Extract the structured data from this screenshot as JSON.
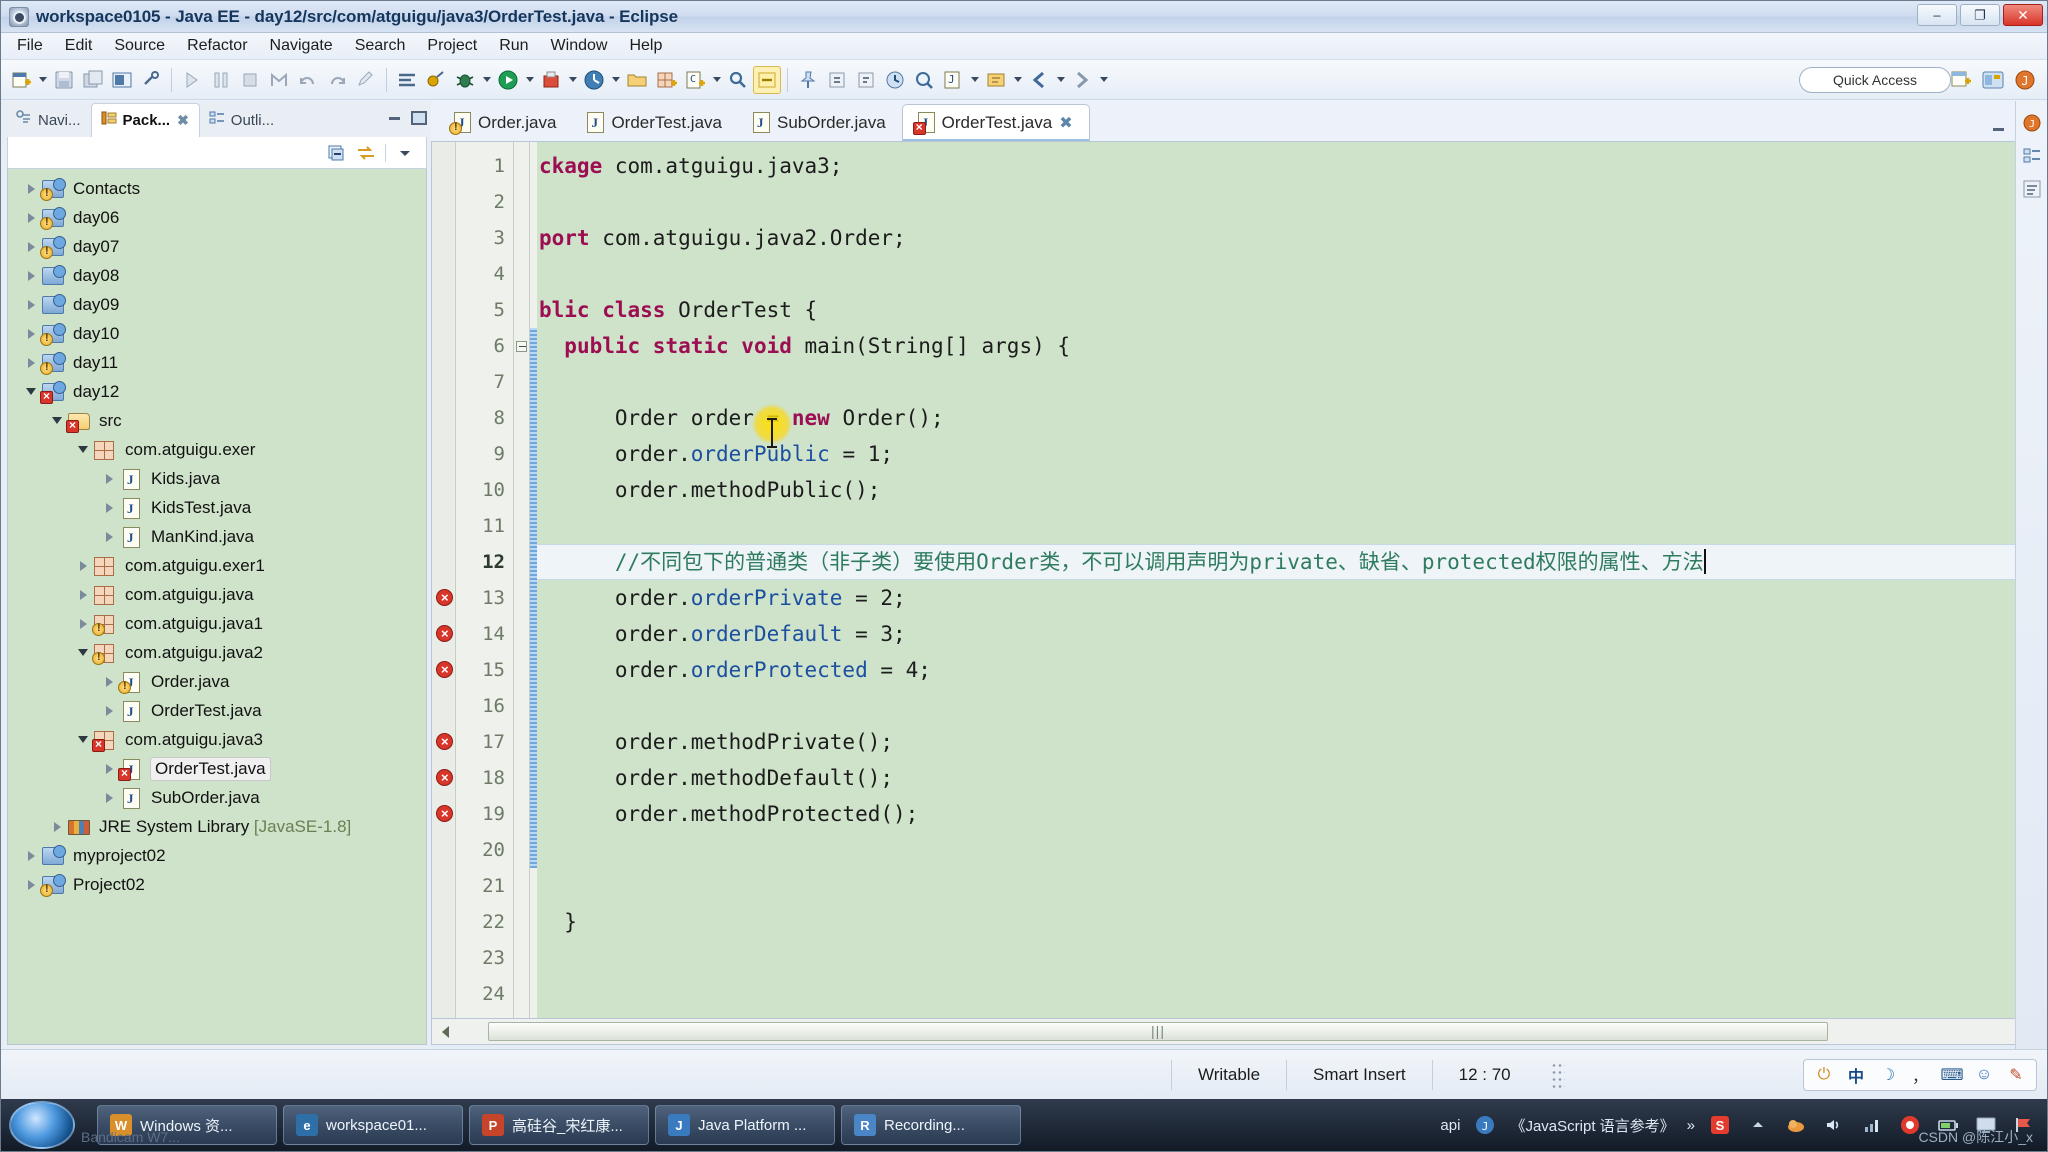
{
  "window": {
    "title": "workspace0105 - Java EE - day12/src/com/atguigu/java3/OrderTest.java - Eclipse",
    "minimize_label": "–",
    "maximize_label": "❐",
    "close_label": "✕"
  },
  "menubar": {
    "items": [
      "File",
      "Edit",
      "Source",
      "Refactor",
      "Navigate",
      "Search",
      "Project",
      "Run",
      "Window",
      "Help"
    ]
  },
  "toolbar": {
    "quick_access": "Quick Access",
    "icons": [
      "new-wizard-icon",
      "new-wizard-dropdown",
      "save-icon",
      "save-all-icon",
      "console-icon",
      "link-break-icon",
      "step-into-icon",
      "step-over-icon",
      "terminate-icon",
      "build-icon",
      "undo-icon",
      "redo-icon",
      "edit-icon",
      "toggle-markers-icon",
      "toggle-breakpoint-icon",
      "debug-icon",
      "debug-dropdown",
      "run-icon",
      "run-dropdown",
      "coverage-icon",
      "coverage-dropdown",
      "profile-icon",
      "profile-dropdown",
      "open-folder-icon",
      "new-package-icon",
      "new-class-icon",
      "new-class-dropdown",
      "search-icon",
      "highlight-icon",
      "pin-icon",
      "next-annotation-icon",
      "previous-annotation-icon",
      "last-edit-icon",
      "search-ref-icon",
      "open-type-icon",
      "open-type-dropdown",
      "open-task-icon",
      "open-task-dropdown",
      "back-icon",
      "back-dropdown",
      "forward-icon",
      "forward-dropdown"
    ],
    "perspective_icons": [
      "new-perspective-icon",
      "java-ee-perspective-icon",
      "java-perspective-icon"
    ]
  },
  "left_panel": {
    "tabs": [
      {
        "label": "Navi...",
        "icon": "navigator-icon",
        "active": false,
        "closable": false
      },
      {
        "label": "Pack...",
        "icon": "package-explorer-icon",
        "active": true,
        "closable": true
      },
      {
        "label": "Outli...",
        "icon": "outline-icon",
        "active": false,
        "closable": false
      }
    ],
    "view_toolbar_icons": [
      "collapse-all-icon",
      "link-with-editor-icon",
      "view-menu-icon"
    ],
    "panel_controls": [
      "minimize-panel-icon",
      "maximize-panel-icon"
    ],
    "tree": [
      {
        "label": "Contacts",
        "indent": 0,
        "state": "closed",
        "icon": "java-project-icon",
        "badge": "warning",
        "selected": false
      },
      {
        "label": "day06",
        "indent": 0,
        "state": "closed",
        "icon": "java-project-icon",
        "badge": "warning",
        "selected": false
      },
      {
        "label": "day07",
        "indent": 0,
        "state": "closed",
        "icon": "java-project-icon",
        "badge": "warning",
        "selected": false
      },
      {
        "label": "day08",
        "indent": 0,
        "state": "closed",
        "icon": "java-project-icon",
        "badge": "none",
        "selected": false
      },
      {
        "label": "day09",
        "indent": 0,
        "state": "closed",
        "icon": "java-project-icon",
        "badge": "none",
        "selected": false
      },
      {
        "label": "day10",
        "indent": 0,
        "state": "closed",
        "icon": "java-project-icon",
        "badge": "warning",
        "selected": false
      },
      {
        "label": "day11",
        "indent": 0,
        "state": "closed",
        "icon": "java-project-icon",
        "badge": "warning",
        "selected": false
      },
      {
        "label": "day12",
        "indent": 0,
        "state": "open",
        "icon": "java-project-icon",
        "badge": "error",
        "selected": false
      },
      {
        "label": "src",
        "indent": 1,
        "state": "open",
        "icon": "source-folder-icon",
        "badge": "error",
        "selected": false
      },
      {
        "label": "com.atguigu.exer",
        "indent": 2,
        "state": "open",
        "icon": "package-icon",
        "badge": "none",
        "selected": false
      },
      {
        "label": "Kids.java",
        "indent": 3,
        "state": "closed",
        "icon": "java-file-icon",
        "badge": "none",
        "selected": false
      },
      {
        "label": "KidsTest.java",
        "indent": 3,
        "state": "closed",
        "icon": "java-file-icon",
        "badge": "none",
        "selected": false
      },
      {
        "label": "ManKind.java",
        "indent": 3,
        "state": "closed",
        "icon": "java-file-icon",
        "badge": "none",
        "selected": false
      },
      {
        "label": "com.atguigu.exer1",
        "indent": 2,
        "state": "closed",
        "icon": "package-icon",
        "badge": "none",
        "selected": false
      },
      {
        "label": "com.atguigu.java",
        "indent": 2,
        "state": "closed",
        "icon": "package-icon",
        "badge": "none",
        "selected": false
      },
      {
        "label": "com.atguigu.java1",
        "indent": 2,
        "state": "closed",
        "icon": "package-icon",
        "badge": "warning",
        "selected": false
      },
      {
        "label": "com.atguigu.java2",
        "indent": 2,
        "state": "open",
        "icon": "package-icon",
        "badge": "warning",
        "selected": false
      },
      {
        "label": "Order.java",
        "indent": 3,
        "state": "closed",
        "icon": "java-file-icon",
        "badge": "warning",
        "selected": false
      },
      {
        "label": "OrderTest.java",
        "indent": 3,
        "state": "closed",
        "icon": "java-file-icon",
        "badge": "none",
        "selected": false
      },
      {
        "label": "com.atguigu.java3",
        "indent": 2,
        "state": "open",
        "icon": "package-icon",
        "badge": "error",
        "selected": false
      },
      {
        "label": "OrderTest.java",
        "indent": 3,
        "state": "closed",
        "icon": "java-file-icon",
        "badge": "error",
        "selected": true
      },
      {
        "label": "SubOrder.java",
        "indent": 3,
        "state": "closed",
        "icon": "java-file-icon",
        "badge": "none",
        "selected": false
      },
      {
        "label": "JRE System Library",
        "label_dim": " [JavaSE-1.8]",
        "indent": 1,
        "state": "closed",
        "icon": "jre-library-icon",
        "badge": "none",
        "selected": false
      },
      {
        "label": "myproject02",
        "indent": 0,
        "state": "closed",
        "icon": "java-project-icon",
        "badge": "none",
        "selected": false
      },
      {
        "label": "Project02",
        "indent": 0,
        "state": "closed",
        "icon": "java-project-icon",
        "badge": "warning",
        "selected": false
      }
    ]
  },
  "editor": {
    "tabs": [
      {
        "label": "Order.java",
        "icon": "java-file-icon",
        "badge": "warning",
        "active": false,
        "closable": false
      },
      {
        "label": "OrderTest.java",
        "icon": "java-file-icon",
        "badge": "none",
        "active": false,
        "closable": false
      },
      {
        "label": "SubOrder.java",
        "icon": "java-file-icon",
        "badge": "none",
        "active": false,
        "closable": false
      },
      {
        "label": "OrderTest.java",
        "icon": "java-file-icon",
        "badge": "error",
        "active": true,
        "closable": true,
        "close_label": "✖"
      }
    ],
    "controls": [
      "minimize-editor-icon",
      "maximize-editor-icon"
    ],
    "scrolled_horizontally": true,
    "lines": [
      {
        "n": 1,
        "marker": "none",
        "fold": false,
        "changed": false,
        "current": false,
        "tokens": [
          {
            "t": "kw",
            "v": "ckage"
          },
          {
            "t": "plain",
            "v": " com.atguigu.java3;"
          }
        ]
      },
      {
        "n": 2,
        "marker": "none",
        "fold": false,
        "changed": false,
        "current": false,
        "tokens": []
      },
      {
        "n": 3,
        "marker": "none",
        "fold": false,
        "changed": false,
        "current": false,
        "tokens": [
          {
            "t": "kw",
            "v": "port"
          },
          {
            "t": "plain",
            "v": " com.atguigu.java2.Order;"
          }
        ]
      },
      {
        "n": 4,
        "marker": "none",
        "fold": false,
        "changed": false,
        "current": false,
        "tokens": []
      },
      {
        "n": 5,
        "marker": "none",
        "fold": false,
        "changed": false,
        "current": false,
        "tokens": [
          {
            "t": "kw",
            "v": "blic class"
          },
          {
            "t": "plain",
            "v": " OrderTest {"
          }
        ]
      },
      {
        "n": 6,
        "marker": "none",
        "fold": true,
        "changed": true,
        "current": false,
        "tokens": [
          {
            "t": "plain",
            "v": "  "
          },
          {
            "t": "kw",
            "v": "public static void"
          },
          {
            "t": "plain",
            "v": " main(String[] args) {"
          }
        ]
      },
      {
        "n": 7,
        "marker": "none",
        "fold": false,
        "changed": true,
        "current": false,
        "tokens": []
      },
      {
        "n": 8,
        "marker": "none",
        "fold": false,
        "changed": true,
        "current": false,
        "tokens": [
          {
            "t": "plain",
            "v": "      Order order = "
          },
          {
            "t": "kw",
            "v": "new"
          },
          {
            "t": "plain",
            "v": " Order();"
          }
        ]
      },
      {
        "n": 9,
        "marker": "none",
        "fold": false,
        "changed": true,
        "current": false,
        "tokens": [
          {
            "t": "plain",
            "v": "      order."
          },
          {
            "t": "fld",
            "v": "orderPublic"
          },
          {
            "t": "plain",
            "v": " = 1;"
          }
        ]
      },
      {
        "n": 10,
        "marker": "none",
        "fold": false,
        "changed": true,
        "current": false,
        "tokens": [
          {
            "t": "plain",
            "v": "      order.methodPublic();"
          }
        ]
      },
      {
        "n": 11,
        "marker": "none",
        "fold": false,
        "changed": true,
        "current": false,
        "tokens": []
      },
      {
        "n": 12,
        "marker": "none",
        "fold": false,
        "changed": true,
        "current": true,
        "tokens": [
          {
            "t": "cmt",
            "v": "      //不同包下的普通类（非子类）要使用Order类，不可以调用声明为private、缺省、protected权限的属性、方法"
          }
        ],
        "caret_at_end": true
      },
      {
        "n": 13,
        "marker": "error",
        "fold": false,
        "changed": true,
        "current": false,
        "tokens": [
          {
            "t": "plain",
            "v": "      order."
          },
          {
            "t": "fld",
            "v": "orderPrivate"
          },
          {
            "t": "plain",
            "v": " = 2;"
          }
        ]
      },
      {
        "n": 14,
        "marker": "error",
        "fold": false,
        "changed": true,
        "current": false,
        "tokens": [
          {
            "t": "plain",
            "v": "      order."
          },
          {
            "t": "fld",
            "v": "orderDefault"
          },
          {
            "t": "plain",
            "v": " = 3;"
          }
        ]
      },
      {
        "n": 15,
        "marker": "error",
        "fold": false,
        "changed": true,
        "current": false,
        "tokens": [
          {
            "t": "plain",
            "v": "      order."
          },
          {
            "t": "fld",
            "v": "orderProtected"
          },
          {
            "t": "plain",
            "v": " = 4;"
          }
        ]
      },
      {
        "n": 16,
        "marker": "none",
        "fold": false,
        "changed": true,
        "current": false,
        "tokens": []
      },
      {
        "n": 17,
        "marker": "error",
        "fold": false,
        "changed": true,
        "current": false,
        "tokens": [
          {
            "t": "plain",
            "v": "      order.methodPrivate();"
          }
        ]
      },
      {
        "n": 18,
        "marker": "error",
        "fold": false,
        "changed": true,
        "current": false,
        "tokens": [
          {
            "t": "plain",
            "v": "      order.methodDefault();"
          }
        ]
      },
      {
        "n": 19,
        "marker": "error",
        "fold": false,
        "changed": true,
        "current": false,
        "tokens": [
          {
            "t": "plain",
            "v": "      order.methodProtected();"
          }
        ]
      },
      {
        "n": 20,
        "marker": "none",
        "fold": false,
        "changed": true,
        "current": false,
        "tokens": []
      },
      {
        "n": 21,
        "marker": "none",
        "fold": false,
        "changed": false,
        "current": false,
        "tokens": []
      },
      {
        "n": 22,
        "marker": "none",
        "fold": false,
        "changed": false,
        "current": false,
        "tokens": [
          {
            "t": "plain",
            "v": "  }"
          }
        ]
      },
      {
        "n": 23,
        "marker": "none",
        "fold": false,
        "changed": false,
        "current": false,
        "tokens": []
      },
      {
        "n": 24,
        "marker": "none",
        "fold": false,
        "changed": false,
        "current": false,
        "tokens": []
      }
    ]
  },
  "right_strip": {
    "icons": [
      "java-perspective-small-icon",
      "outline-view-icon",
      "task-list-icon"
    ]
  },
  "statusbar": {
    "writable": "Writable",
    "insert_mode": "Smart Insert",
    "position": "12 : 70",
    "ime": {
      "power_icon": "⏻",
      "lang": "中",
      "moon_icon": "☽",
      "comma_icon": "，",
      "keyboard_icon": "⌨",
      "person_icon": "☺",
      "tool_icon": "✎"
    }
  },
  "taskbar": {
    "start_label": "start-orb",
    "buttons": [
      {
        "label": "Windows 资...",
        "icon_letter": "W",
        "icon_color": "#d98f2a"
      },
      {
        "label": "workspace01...",
        "icon_letter": "e",
        "icon_color": "#2f6fa8"
      },
      {
        "label": "高硅谷_宋红康...",
        "icon_letter": "P",
        "icon_color": "#c6452a"
      },
      {
        "label": "Java Platform ...",
        "icon_letter": "J",
        "icon_color": "#3a7bbf"
      },
      {
        "label": "Recording...",
        "icon_letter": "R",
        "icon_color": "#4a86c6"
      }
    ],
    "tray_text_api": "api",
    "tray_book": "《JavaScript 语言参考》",
    "tray_chevron": "»",
    "tray_icons": [
      "s-logo-icon",
      "up-chevron-icon",
      "cloud-icon",
      "volume-icon",
      "network-icon",
      "record-dot-icon",
      "battery-icon",
      "screen-icon",
      "flag-icon"
    ],
    "watermark": "CSDN @陈江小_x",
    "watermark_left": "Bandicam W7..."
  }
}
